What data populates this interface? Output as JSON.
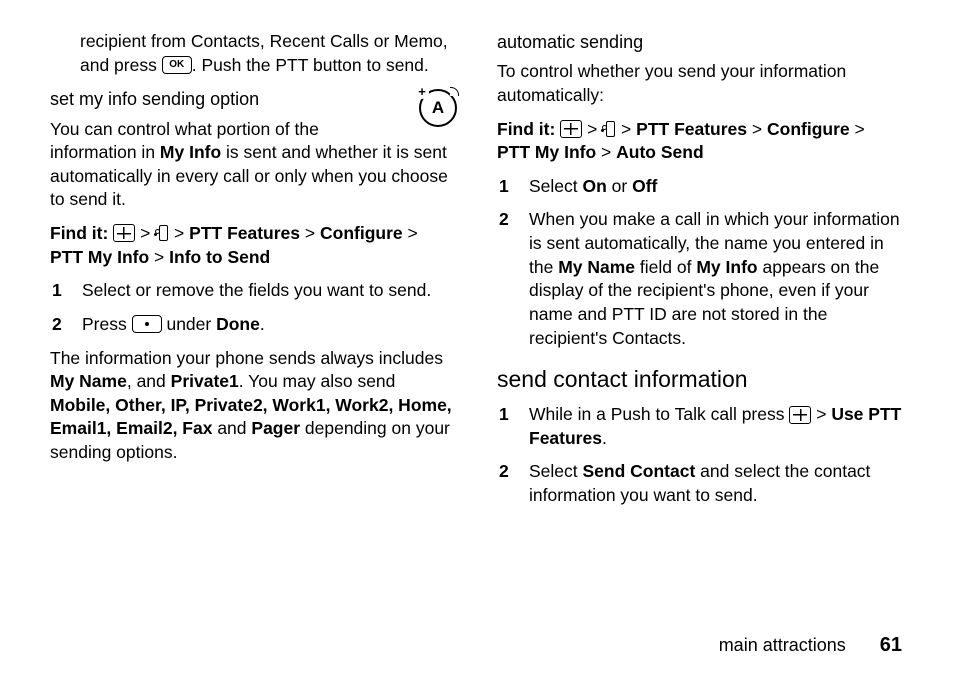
{
  "left": {
    "intro_partial": {
      "pre": "recipient from Contacts, Recent Calls or Memo, and press ",
      "ok_label": "OK",
      "post": ". Push the PTT button to send."
    },
    "heading1": "set my info sending option",
    "para1": {
      "p1": "You can control what portion of the information in ",
      "b1": "My Info",
      "p2": " is sent and whether it is sent automatically in every call or only when you choose to send it."
    },
    "find_label": "Find it:",
    "nav1": {
      "a": "PTT Features",
      "b": "Configure",
      "c": "PTT My Info",
      "d": "Info to Send"
    },
    "steps1": {
      "s1": "Select or remove the fields you want to send.",
      "s2_pre": "Press ",
      "s2_mid": " under ",
      "s2_done": "Done",
      "s2_post": "."
    },
    "para2": {
      "p1": "The information your phone sends always includes ",
      "b1": "My Name",
      "p2": ", and ",
      "b2": "Private1",
      "p3": ". You may also send ",
      "b3": "Mobile, Other, IP, Private2, Work1, Work2, Home, Email1, Email2, Fax",
      "p4": " and ",
      "b4": "Pager",
      "p5": " depending on your sending options."
    }
  },
  "right": {
    "heading1": "automatic sending",
    "para1": "To control whether you send your information automatically:",
    "find_label": "Find it:",
    "nav1": {
      "a": "PTT Features",
      "b": "Configure",
      "c": "PTT My Info",
      "d": "Auto Send"
    },
    "steps1": {
      "s1_pre": "Select ",
      "s1_on": "On",
      "s1_or": " or ",
      "s1_off": "Off",
      "s2_p1": "When you make a call in which your information is sent automatically, the name you entered in the ",
      "s2_b1": "My Name",
      "s2_p2": " field of ",
      "s2_b2": "My Info",
      "s2_p3": " appears on the display of the recipient's phone, even if your name and PTT ID are not stored in the recipient's Contacts."
    },
    "heading2": "send contact information",
    "steps2": {
      "s1_pre": "While in a Push to Talk call press ",
      "s1_mid": " > ",
      "s1_b": "Use PTT Features",
      "s1_post": ".",
      "s2_pre": "Select ",
      "s2_b": "Send Contact",
      "s2_post": " and select the contact information you want to send."
    }
  },
  "footer": {
    "label": "main attractions",
    "page": "61"
  },
  "gt": ">"
}
